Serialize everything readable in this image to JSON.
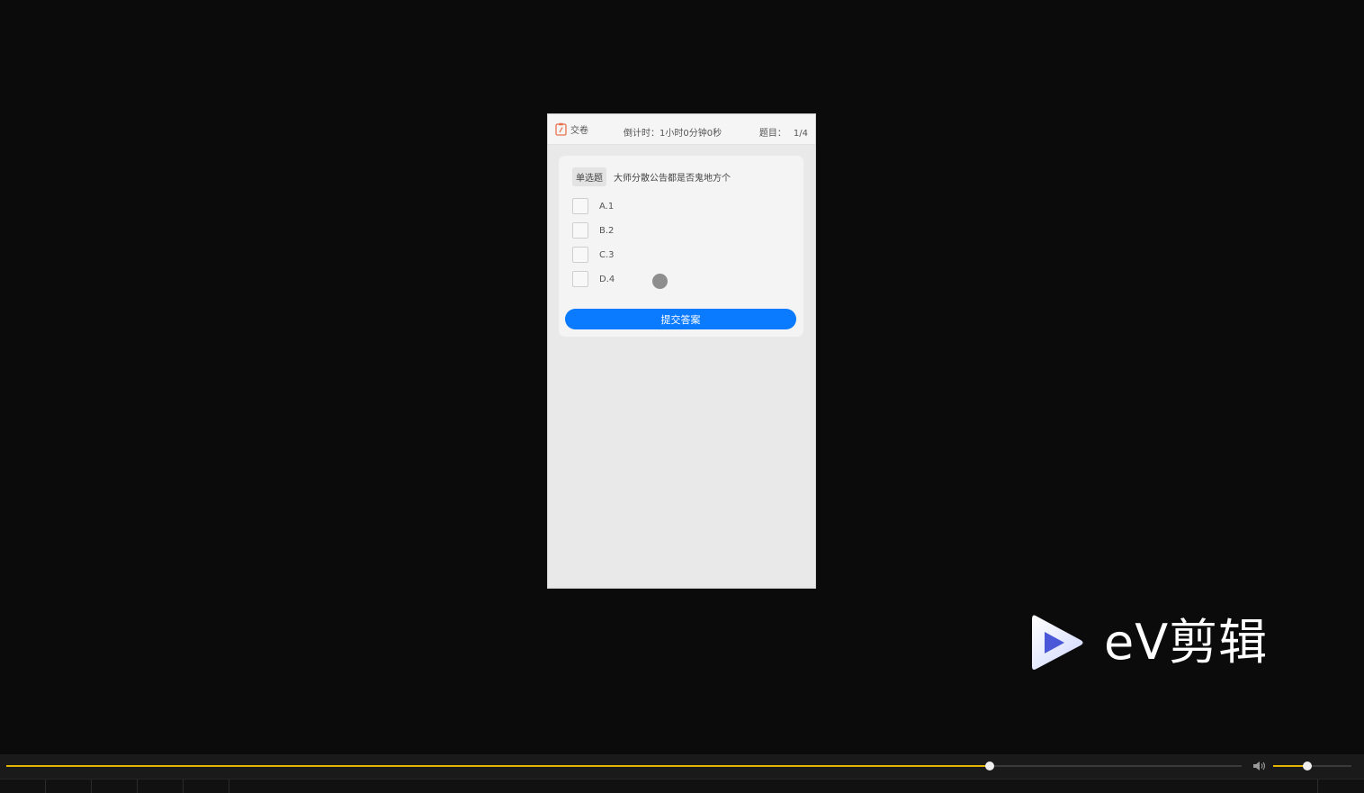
{
  "quiz": {
    "submit_exam_label": "交卷",
    "timer_text": "倒计时：1小时0分钟0秒",
    "question_counter_label": "题目：",
    "question_counter_value": "1/4",
    "question_type": "单选题",
    "question_text": "大师分散公告都是否鬼地方个",
    "options": [
      {
        "label": "A.1"
      },
      {
        "label": "B.2"
      },
      {
        "label": "C.3"
      },
      {
        "label": "D.4"
      }
    ],
    "submit_answer_label": "提交答案"
  },
  "watermark": {
    "text": "eV剪辑"
  },
  "player": {
    "progress_fraction": 0.796,
    "volume_fraction": 0.44,
    "accent_color": "#e0b400"
  }
}
